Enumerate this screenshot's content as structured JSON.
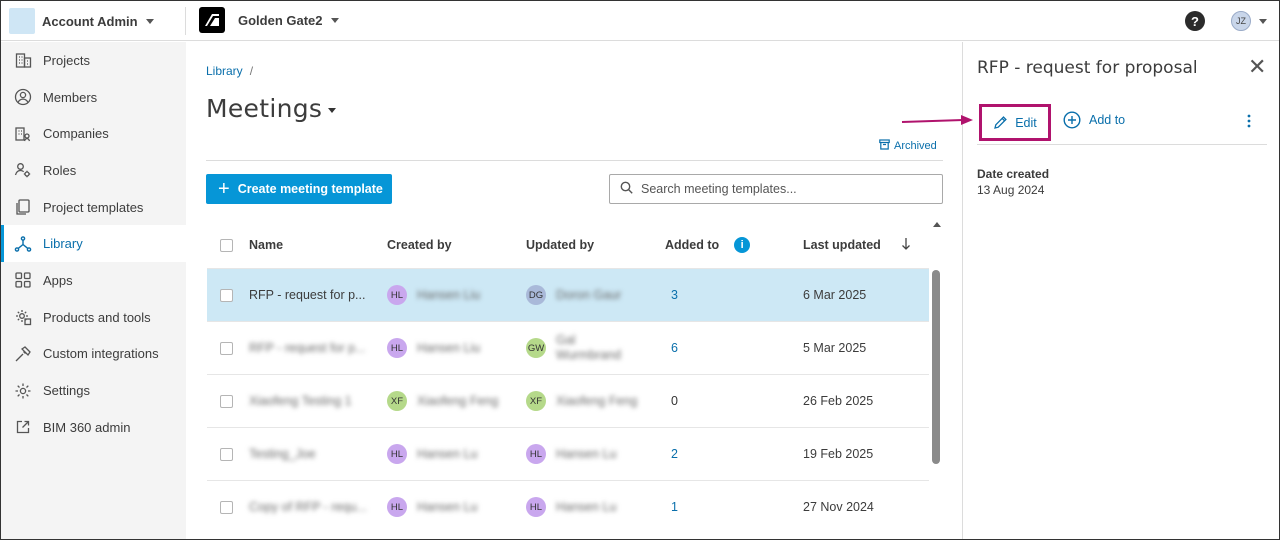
{
  "topbar": {
    "account_name": "Account Admin",
    "project_name": "Golden Gate2",
    "help_label": "?",
    "user_initials": "JZ"
  },
  "sidebar": {
    "items": [
      {
        "label": "Projects",
        "icon": "building-icon"
      },
      {
        "label": "Members",
        "icon": "person-icon"
      },
      {
        "label": "Companies",
        "icon": "company-icon"
      },
      {
        "label": "Roles",
        "icon": "role-icon"
      },
      {
        "label": "Project templates",
        "icon": "template-icon"
      },
      {
        "label": "Library",
        "icon": "library-icon",
        "active": true
      },
      {
        "label": "Apps",
        "icon": "apps-grid-icon"
      },
      {
        "label": "Products and tools",
        "icon": "gear-box-icon"
      },
      {
        "label": "Custom integrations",
        "icon": "tools-icon"
      },
      {
        "label": "Settings",
        "icon": "gear-icon"
      },
      {
        "label": "BIM 360 admin",
        "icon": "external-link-icon"
      }
    ]
  },
  "main": {
    "breadcrumb": "Library",
    "breadcrumb_sep": "/",
    "title": "Meetings",
    "archived_label": "Archived",
    "create_button": "Create meeting template",
    "search_placeholder": "Search meeting templates...",
    "columns": {
      "name": "Name",
      "created_by": "Created by",
      "updated_by": "Updated by",
      "added_to": "Added to",
      "last_updated": "Last updated"
    },
    "rows": [
      {
        "name": "RFP - request for p...",
        "created_initials": "HL",
        "created_name": "Hansen Liu",
        "updated_initials": "DG",
        "updated_name": "Doron Gaur",
        "added_to": "3",
        "last_updated": "6 Mar 2025"
      },
      {
        "name": "RFP - request for p...",
        "created_initials": "HL",
        "created_name": "Hansen Liu",
        "updated_initials": "GW",
        "updated_name": "Gal Wurmbrand",
        "added_to": "6",
        "last_updated": "5 Mar 2025"
      },
      {
        "name": "Xiaofeng Testing 1",
        "created_initials": "XF",
        "created_name": "Xiaofeng Feng",
        "updated_initials": "XF",
        "updated_name": "Xiaofeng Feng",
        "added_to": "0",
        "last_updated": "26 Feb 2025"
      },
      {
        "name": "Testing_Joe",
        "created_initials": "HL",
        "created_name": "Hansen Lu",
        "updated_initials": "HL",
        "updated_name": "Hansen Lu",
        "added_to": "2",
        "last_updated": "19 Feb 2025"
      },
      {
        "name": "Copy of RFP - requ...",
        "created_initials": "HL",
        "created_name": "Hansen Lu",
        "updated_initials": "HL",
        "updated_name": "Hansen Lu",
        "added_to": "1",
        "last_updated": "27 Nov 2024"
      }
    ]
  },
  "panel": {
    "title": "RFP - request for proposal",
    "edit_label": "Edit",
    "add_to_label": "Add to",
    "date_created_label": "Date created",
    "date_created_value": "13 Aug 2024"
  },
  "colors": {
    "accent": "#0696d7",
    "link": "#0a6fab",
    "selected_row": "#cde8f5",
    "highlight_box": "#b0136d"
  }
}
